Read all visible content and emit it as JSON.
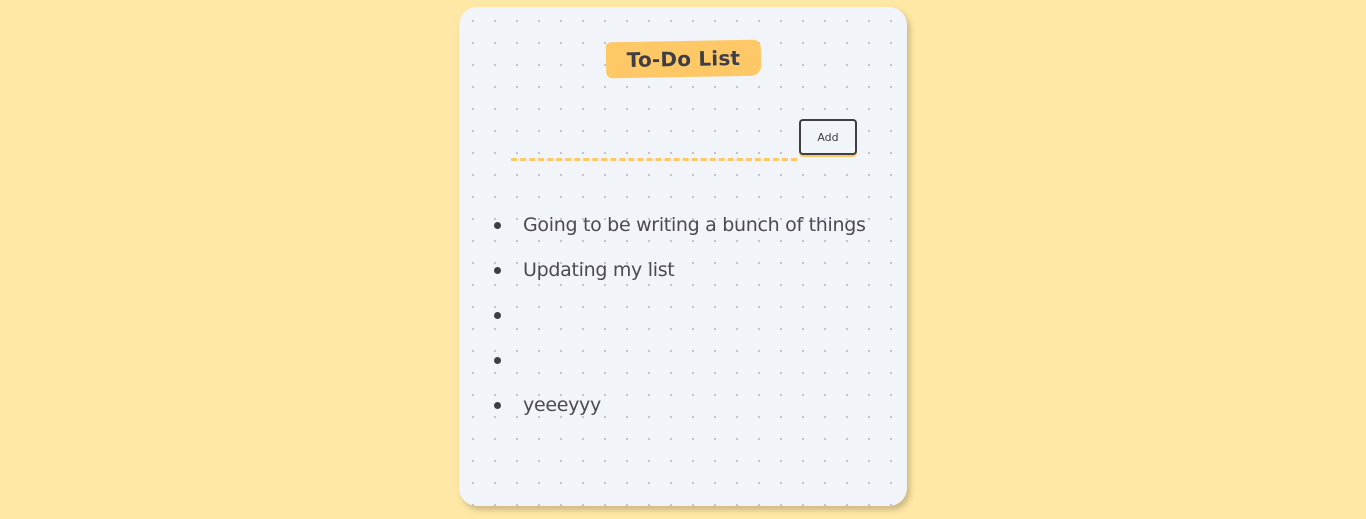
{
  "header": {
    "title": "To-Do List"
  },
  "form": {
    "input_value": "",
    "input_placeholder": "",
    "add_label": "Add"
  },
  "tasks": [
    {
      "text": "Going to be writing a bunch of things"
    },
    {
      "text": "Updating my list"
    },
    {
      "text": ""
    },
    {
      "text": ""
    },
    {
      "text": "yeeeyyy"
    }
  ],
  "colors": {
    "page_background": "#ffe7a5",
    "card_background": "#f1f4f8",
    "accent": "#ffc867",
    "ink": "#3e3e44"
  }
}
